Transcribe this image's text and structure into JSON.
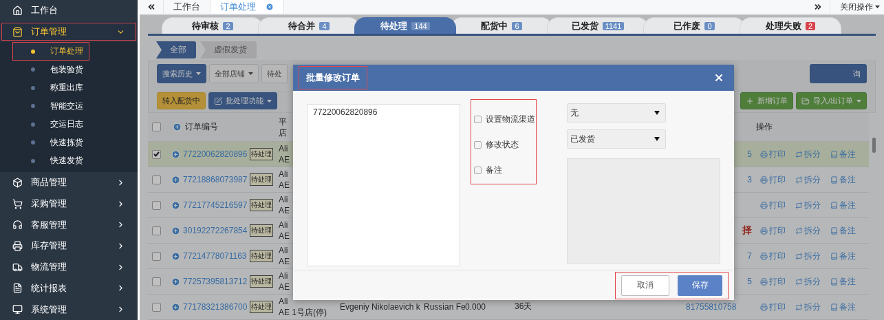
{
  "sidebar": {
    "items": [
      {
        "label": "工作台",
        "kind": "link",
        "selected": false
      },
      {
        "label": "订单管理",
        "kind": "group",
        "expanded": true,
        "selected": true,
        "annotated": true,
        "children": [
          {
            "label": "订单处理",
            "selected": true,
            "annotated": true
          },
          {
            "label": "包装验货",
            "selected": false,
            "annotated": false
          },
          {
            "label": "称重出库",
            "selected": false,
            "annotated": false
          },
          {
            "label": "智能交运",
            "selected": false,
            "annotated": false
          },
          {
            "label": "交运日志",
            "selected": false,
            "annotated": false
          },
          {
            "label": "快速拣货",
            "selected": false,
            "annotated": false
          },
          {
            "label": "快速发货",
            "selected": false,
            "annotated": false
          }
        ]
      },
      {
        "label": "商品管理",
        "kind": "group",
        "expanded": false,
        "selected": false,
        "annotated": false
      },
      {
        "label": "采购管理",
        "kind": "group",
        "expanded": false,
        "selected": false,
        "annotated": false
      },
      {
        "label": "客服管理",
        "kind": "group",
        "expanded": false,
        "selected": false,
        "annotated": false
      },
      {
        "label": "库存管理",
        "kind": "group",
        "expanded": false,
        "selected": false,
        "annotated": false
      },
      {
        "label": "物流管理",
        "kind": "group",
        "expanded": false,
        "selected": false,
        "annotated": false
      },
      {
        "label": "统计报表",
        "kind": "group",
        "expanded": false,
        "selected": false,
        "annotated": false
      },
      {
        "label": "系统管理",
        "kind": "group",
        "expanded": false,
        "selected": false,
        "annotated": false
      }
    ]
  },
  "top_tabs": {
    "items": [
      {
        "label": "工作台",
        "selected": false,
        "closable": false
      },
      {
        "label": "订单处理",
        "selected": true,
        "closable": true
      }
    ],
    "close_menu": "关闭操作"
  },
  "status_tabs": [
    {
      "label": "待审核",
      "count": "2",
      "selected": false,
      "alert": false
    },
    {
      "label": "待合并",
      "count": "4",
      "selected": false,
      "alert": false
    },
    {
      "label": "待处理",
      "count": "144",
      "selected": true,
      "alert": false
    },
    {
      "label": "配货中",
      "count": "6",
      "selected": false,
      "alert": false
    },
    {
      "label": "已发货",
      "count": "1141",
      "selected": false,
      "alert": false
    },
    {
      "label": "已作废",
      "count": "0",
      "selected": false,
      "alert": false
    },
    {
      "label": "处理失败",
      "count": "2",
      "selected": false,
      "alert": true
    }
  ],
  "sub_tabs": [
    {
      "label": "全部",
      "selected": true
    },
    {
      "label": "虚假发货",
      "selected": false
    }
  ],
  "filters": [
    {
      "label": "搜索历史",
      "kind": "primary",
      "dropdown": true
    },
    {
      "label": "全部店铺",
      "kind": "default",
      "dropdown": true
    },
    {
      "label": "待处",
      "kind": "default",
      "dropdown": false
    }
  ],
  "filters_right": [
    {
      "label": "询",
      "kind": "primary",
      "dropdown": false
    }
  ],
  "actions": [
    {
      "label": "转入配货中",
      "kind": "warning",
      "dropdown": false
    },
    {
      "label": "批处理功能",
      "kind": "primary",
      "dropdown": true
    }
  ],
  "actions_right": [
    {
      "label": "新增订单",
      "kind": "success",
      "dropdown": false
    },
    {
      "label": "导入/出订单",
      "kind": "success",
      "dropdown": true
    }
  ],
  "table": {
    "header": {
      "all_checked": false,
      "order_no": "订单编号",
      "column_3": [
        "平",
        "店"
      ],
      "actions": "操作"
    },
    "rows": [
      {
        "order_no": "77220062820896",
        "status": "待处理",
        "checked": true,
        "column_3": [
          "Ali",
          "AE"
        ],
        "column_9": {
          "text": "5",
          "alert": false
        },
        "actions": [
          "打印",
          "拆分",
          "备注"
        ]
      },
      {
        "order_no": "77218868073987",
        "status": "待处理",
        "checked": false,
        "column_3": [
          "Ali",
          "AE"
        ],
        "column_9": {
          "text": "3",
          "alert": false
        },
        "actions": [
          "打印",
          "拆分",
          "备注"
        ]
      },
      {
        "order_no": "77217745216597",
        "status": "待处理",
        "checked": false,
        "column_3": [
          "Ali",
          "AE"
        ],
        "actions": [
          "打印",
          "拆分",
          "备注"
        ]
      },
      {
        "order_no": "30192272267854",
        "status": "待处理",
        "checked": false,
        "column_3": [
          "Ali",
          "AE"
        ],
        "column_9": {
          "text": "择",
          "alert": true
        },
        "actions": [
          "打印",
          "拆分",
          "备注"
        ]
      },
      {
        "order_no": "77214778071163",
        "status": "待处理",
        "checked": false,
        "column_3": [
          "Ali",
          "AE"
        ],
        "column_9": {
          "text": "7",
          "alert": false
        },
        "actions": [
          "打印",
          "拆分",
          "备注"
        ]
      },
      {
        "order_no": "77257395813712",
        "status": "待处理",
        "checked": false,
        "column_3": [
          "Ali",
          "AE"
        ],
        "column_9": {
          "text": "5",
          "alert": false
        },
        "actions": [
          "打印",
          "拆分",
          "备注"
        ]
      },
      {
        "order_no": "77178321386700",
        "status": "待处理",
        "checked": false,
        "column_3": [
          "Ali",
          "AE 1号店(停)"
        ],
        "column_4": "Evgeniy Nikolaevich k",
        "column_5": "Russian Fe",
        "column_6": "0.000",
        "column_7": "36天",
        "column_9": {
          "text": "81755810758",
          "alert": false
        },
        "actions": [
          "打印",
          "拆分",
          "备注"
        ]
      }
    ]
  },
  "modal": {
    "title": "批量修改订单",
    "title_annotated": true,
    "order_numbers": "77220062820896",
    "options_annotated": true,
    "options": [
      {
        "label": "设置物流渠道",
        "checked": false
      },
      {
        "label": "修改状态",
        "checked": false
      },
      {
        "label": "备注",
        "checked": false
      }
    ],
    "selects": [
      {
        "value": "无"
      },
      {
        "value": "已发货"
      }
    ],
    "note": {
      "disabled": true
    },
    "buttons_annotated": true,
    "buttons": [
      {
        "label": "取消",
        "kind": "default"
      },
      {
        "label": "保存",
        "kind": "primary"
      }
    ]
  }
}
